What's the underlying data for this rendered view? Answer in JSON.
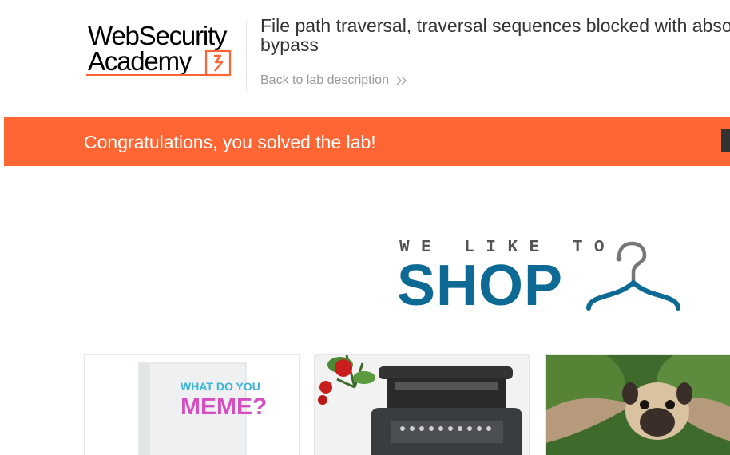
{
  "header": {
    "logo_line1": "WebSecurity",
    "logo_line2": "Academy",
    "lab_title": "File path traversal, traversal sequences blocked with absolute path bypass",
    "back_link_label": "Back to lab description"
  },
  "banner": {
    "message": "Congratulations, you solved the lab!"
  },
  "hero": {
    "tagline": "WE LIKE TO",
    "title": "SHOP"
  },
  "products": [
    {
      "image_text_1": "WHAT DO YOU",
      "image_text_2": "MEME?"
    },
    {
      "image_text_1": ""
    },
    {
      "image_text_1": ""
    }
  ],
  "colors": {
    "brand_orange": "#ff6633",
    "shop_blue": "#0d6a94"
  },
  "icons": {
    "back_link": "double-chevron-right-icon",
    "hero": "hanger-icon",
    "logo": "lab-flask-icon"
  }
}
